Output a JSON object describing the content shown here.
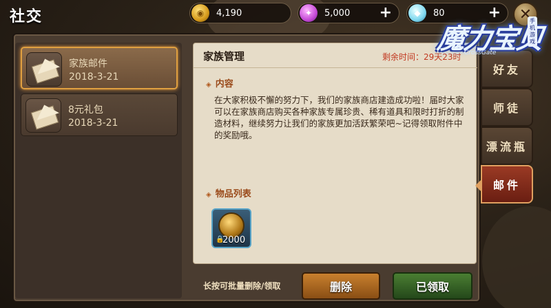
{
  "window": {
    "title": "社交"
  },
  "resources": [
    {
      "icon": "gold-coin-icon",
      "value": "4,190",
      "has_plus": false
    },
    {
      "icon": "purple-gem-icon",
      "value": "5,000",
      "has_plus": true
    },
    {
      "icon": "diamond-icon",
      "value": "80",
      "has_plus": true
    }
  ],
  "logo": {
    "text": "魔力宝贝",
    "sub": "CrossGate",
    "side": "手机游戏"
  },
  "mail_list": [
    {
      "title": "家族邮件",
      "date": "2018-3-21",
      "selected": true
    },
    {
      "title": "8元礼包",
      "date": "2018-3-21",
      "selected": false
    }
  ],
  "detail": {
    "title": "家族管理",
    "remaining": "剩余时间：29天23时",
    "content_label": "内容",
    "content": "在大家积极不懈的努力下，我们的家族商店建造成功啦！届时大家可以在家族商店购买各种家族专属珍贵、稀有道具和限时打折的制造材料，继续努力让我们的家族更加活跃繁荣吧~记得领取附件中的奖励哦。",
    "items_label": "物品列表",
    "items": [
      {
        "icon": "gold-coin-icon",
        "count": "2000",
        "locked": true
      }
    ]
  },
  "footer": {
    "hint": "长按可批量删除/领取",
    "delete_label": "删除",
    "claimed_label": "已领取"
  },
  "tabs": [
    {
      "label": "好友",
      "active": false
    },
    {
      "label": "师徒",
      "active": false
    },
    {
      "label": "漂流瓶",
      "active": false
    },
    {
      "label": "邮件",
      "active": true
    }
  ]
}
